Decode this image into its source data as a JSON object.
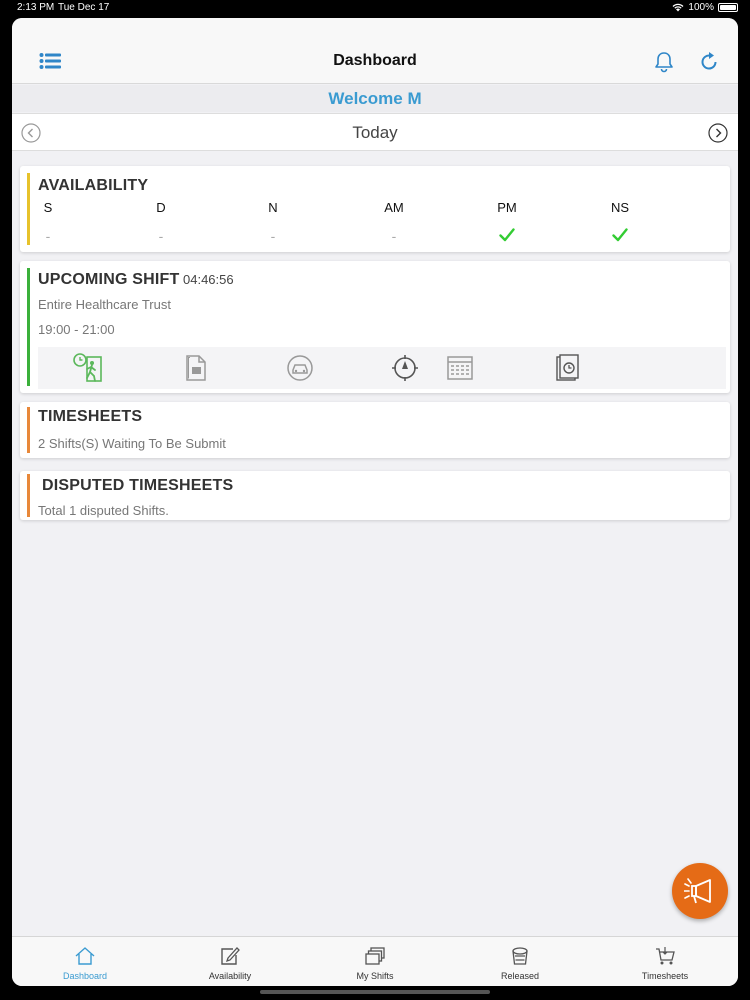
{
  "status": {
    "time": "2:13 PM",
    "date": "Tue Dec 17",
    "battery": "100%"
  },
  "nav": {
    "title": "Dashboard"
  },
  "welcome": "Welcome M",
  "date_nav": {
    "label": "Today"
  },
  "availability": {
    "title": "AVAILABILITY",
    "columns": [
      {
        "key": "S",
        "value": "-",
        "checked": false
      },
      {
        "key": "D",
        "value": "-",
        "checked": false
      },
      {
        "key": "N",
        "value": "-",
        "checked": false
      },
      {
        "key": "AM",
        "value": "-",
        "checked": false
      },
      {
        "key": "PM",
        "value": "",
        "checked": true
      },
      {
        "key": "NS",
        "value": "",
        "checked": true
      }
    ]
  },
  "upcoming": {
    "title": "UPCOMING SHIFT",
    "countdown": "04:46:56",
    "trust": "Entire Healthcare Trust",
    "time": "19:00 - 21:00"
  },
  "timesheets": {
    "title": "TIMESHEETS",
    "subtitle": "2 Shifts(S) Waiting To Be Submit"
  },
  "disputed": {
    "title": "DISPUTED TIMESHEETS",
    "subtitle": "Total 1 disputed Shifts."
  },
  "tabs": [
    {
      "label": "Dashboard",
      "icon": "home-icon",
      "active": true
    },
    {
      "label": "Availability",
      "icon": "edit-icon",
      "active": false
    },
    {
      "label": "My Shifts",
      "icon": "layers-icon",
      "active": false
    },
    {
      "label": "Released",
      "icon": "bucket-icon",
      "active": false
    },
    {
      "label": "Timesheets",
      "icon": "cart-icon",
      "active": false
    }
  ],
  "colors": {
    "accent": "#3a9bd1",
    "availability_bar": "#e7c22b",
    "shift_bar": "#3bb03b",
    "timesheet_bar": "#e8883a",
    "fab": "#e56b16"
  }
}
